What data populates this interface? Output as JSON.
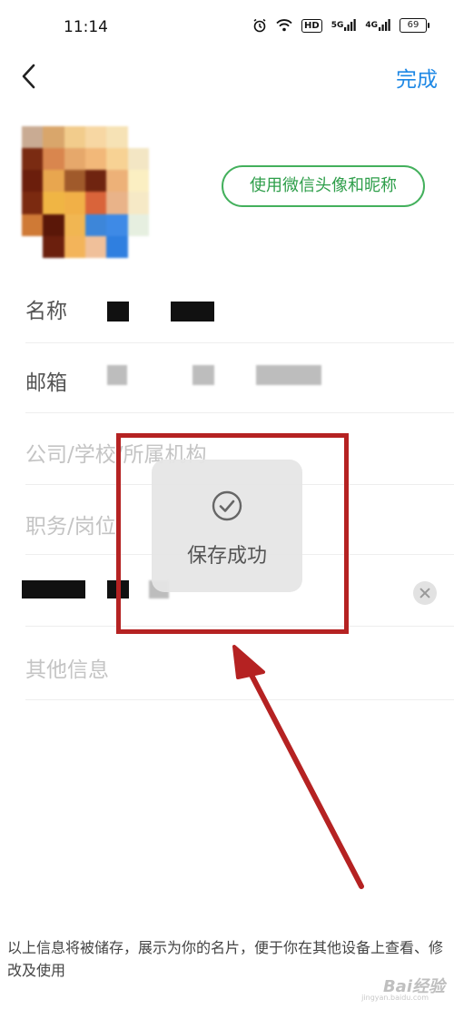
{
  "status_bar": {
    "time": "11:14",
    "hd_badge": "HD",
    "signal_1": "5G",
    "signal_2": "4G",
    "battery": "69"
  },
  "header": {
    "back_icon": "chevron-left-icon",
    "done_label": "完成"
  },
  "profile": {
    "wechat_button_label": "使用微信头像和昵称"
  },
  "form": {
    "name_label": "名称",
    "email_label": "邮箱",
    "org_placeholder": "公司/学校/所属机构",
    "title_placeholder": "职务/岗位",
    "other_placeholder": "其他信息"
  },
  "toast": {
    "icon": "check-circle-icon",
    "message": "保存成功"
  },
  "footer": {
    "note": "以上信息将被储存，展示为你的名片，便于你在其他设备上查看、修改及使用"
  },
  "watermark": {
    "text": "Bai经验",
    "sub": "jingyan.baidu.com"
  },
  "colors": {
    "accent_blue": "#1e88e5",
    "wechat_green": "#43b05c",
    "annotation_red": "#b52222"
  }
}
